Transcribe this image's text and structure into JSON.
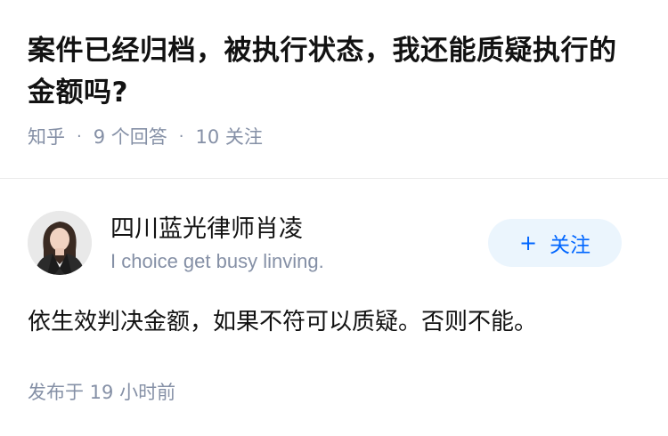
{
  "question": {
    "title": "案件已经归档，被执行状态，我还能质疑执行的金额吗?",
    "source": "知乎",
    "answers_count": "9 个回答",
    "followers_count": "10 关注",
    "separator": "·"
  },
  "answer": {
    "author": {
      "name": "四川蓝光律师肖凌",
      "bio": "I choice get busy linving."
    },
    "follow_button": {
      "icon": "plus-icon",
      "icon_glyph": "+",
      "label": "关注"
    },
    "content": "依生效判决金额，如果不符可以质疑。否则不能。",
    "time": "发布于  19 小时前"
  },
  "colors": {
    "text_primary": "#121212",
    "text_secondary": "#8590a6",
    "accent": "#0066ff",
    "follow_bg": "#ebf5fd",
    "divider": "#ebebeb"
  }
}
